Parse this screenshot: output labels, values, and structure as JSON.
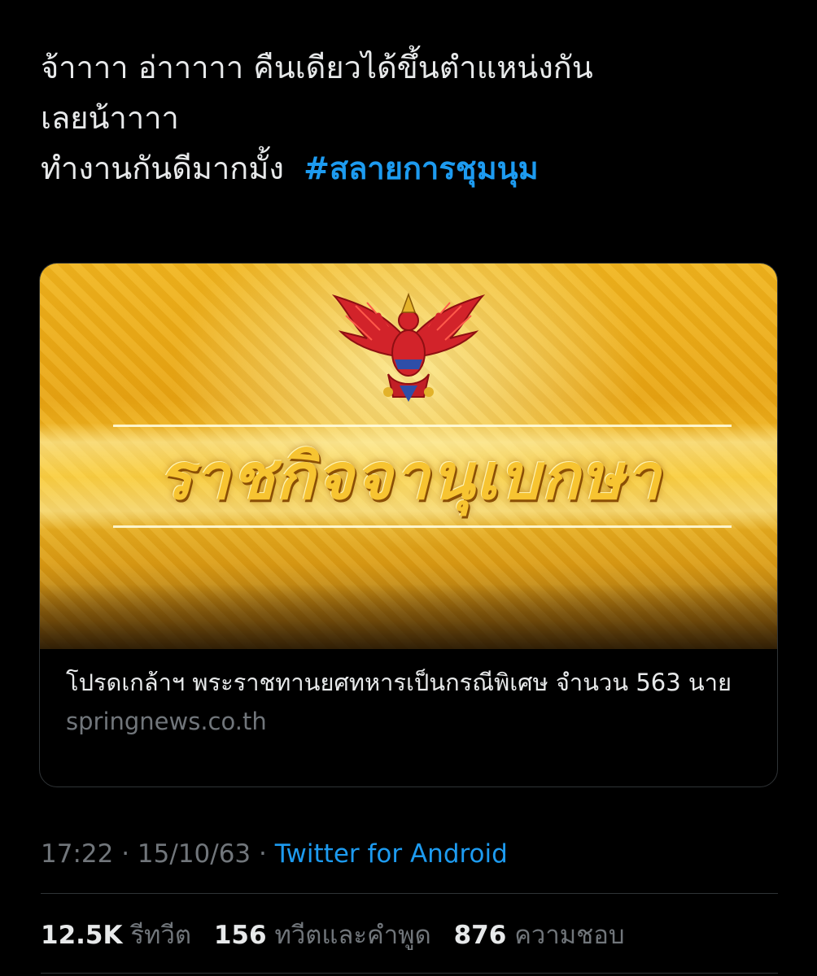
{
  "tweet": {
    "line1": "จ้าาาา อ่าาาาา คืนเดียวได้ขึ้นตำแหน่งกัน",
    "line2": "เลยน้าาาา",
    "line3": "ทำงานกันดีมากมั้ง",
    "hashtag": "#สลายการชุมนุม"
  },
  "card": {
    "image_text": "ราชกิจจานุเบกษา",
    "title": "โปรดเกล้าฯ พระราชทานยศทหารเป็นกรณีพิเศษ จำนวน 563 นาย",
    "domain": "springnews.co.th"
  },
  "meta": {
    "time": "17:22",
    "date": "15/10/63",
    "separator": "·",
    "source": "Twitter for Android"
  },
  "stats": {
    "retweets": "12.5K",
    "retweets_label": "รีทวีต",
    "quotes": "156",
    "quotes_label": "ทวีตและคำพูด",
    "likes": "876",
    "likes_label": "ความชอบ"
  },
  "colors": {
    "background": "#000000",
    "text": "#e7e9ea",
    "secondary": "#71767b",
    "link": "#1d9bf0",
    "border": "#2f3336"
  }
}
